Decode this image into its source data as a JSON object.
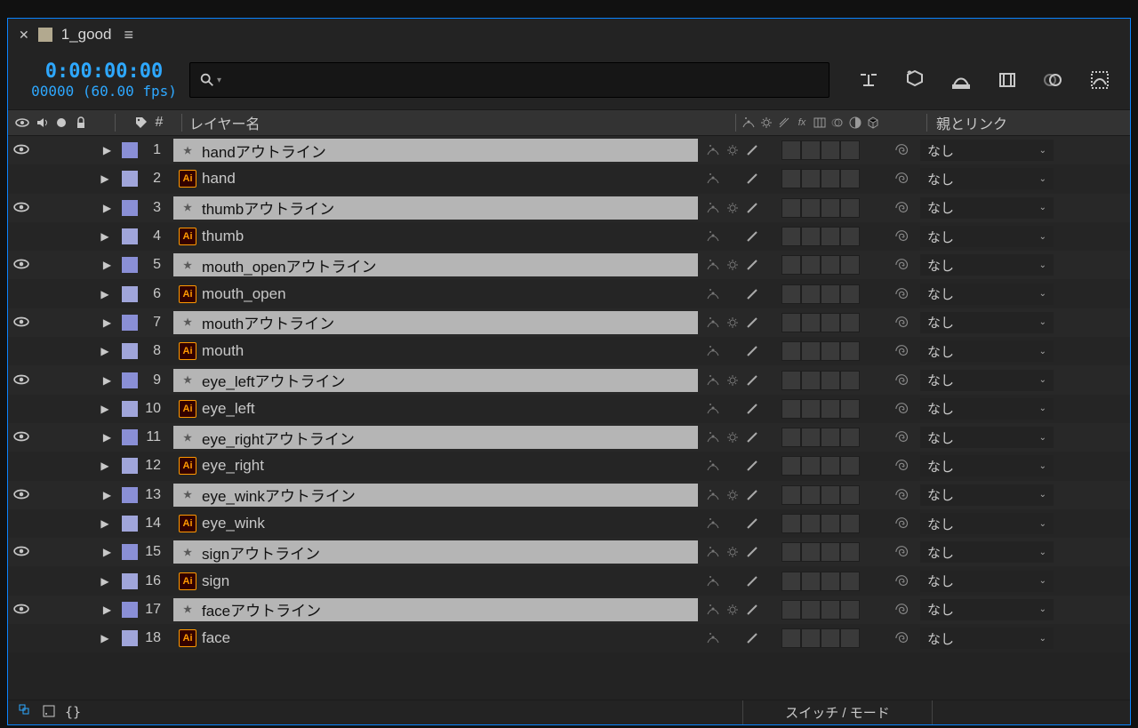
{
  "tab": {
    "name": "1_good"
  },
  "header": {
    "timecode": "0:00:00:00",
    "fps": "00000 (60.00 fps)"
  },
  "columns": {
    "layer_name_label": "レイヤー名",
    "number_label": "#",
    "parent_label": "親とリンク"
  },
  "layers": [
    {
      "num": "1",
      "type": "shape",
      "visible": true,
      "name": "handアウトライン",
      "parent": "なし"
    },
    {
      "num": "2",
      "type": "ai",
      "visible": false,
      "name": "hand",
      "parent": "なし"
    },
    {
      "num": "3",
      "type": "shape",
      "visible": true,
      "name": "thumbアウトライン",
      "parent": "なし"
    },
    {
      "num": "4",
      "type": "ai",
      "visible": false,
      "name": "thumb",
      "parent": "なし"
    },
    {
      "num": "5",
      "type": "shape",
      "visible": true,
      "name": "mouth_openアウトライン",
      "parent": "なし"
    },
    {
      "num": "6",
      "type": "ai",
      "visible": false,
      "name": "mouth_open",
      "parent": "なし"
    },
    {
      "num": "7",
      "type": "shape",
      "visible": true,
      "name": "mouthアウトライン",
      "parent": "なし"
    },
    {
      "num": "8",
      "type": "ai",
      "visible": false,
      "name": "mouth",
      "parent": "なし"
    },
    {
      "num": "9",
      "type": "shape",
      "visible": true,
      "name": "eye_leftアウトライン",
      "parent": "なし"
    },
    {
      "num": "10",
      "type": "ai",
      "visible": false,
      "name": "eye_left",
      "parent": "なし"
    },
    {
      "num": "11",
      "type": "shape",
      "visible": true,
      "name": "eye_rightアウトライン",
      "parent": "なし"
    },
    {
      "num": "12",
      "type": "ai",
      "visible": false,
      "name": "eye_right",
      "parent": "なし"
    },
    {
      "num": "13",
      "type": "shape",
      "visible": true,
      "name": "eye_winkアウトライン",
      "parent": "なし"
    },
    {
      "num": "14",
      "type": "ai",
      "visible": false,
      "name": "eye_wink",
      "parent": "なし"
    },
    {
      "num": "15",
      "type": "shape",
      "visible": true,
      "name": "signアウトライン",
      "parent": "なし"
    },
    {
      "num": "16",
      "type": "ai",
      "visible": false,
      "name": "sign",
      "parent": "なし"
    },
    {
      "num": "17",
      "type": "shape",
      "visible": true,
      "name": "faceアウトライン",
      "parent": "なし"
    },
    {
      "num": "18",
      "type": "ai",
      "visible": false,
      "name": "face",
      "parent": "なし"
    }
  ],
  "footer": {
    "switch_mode": "スイッチ / モード"
  }
}
